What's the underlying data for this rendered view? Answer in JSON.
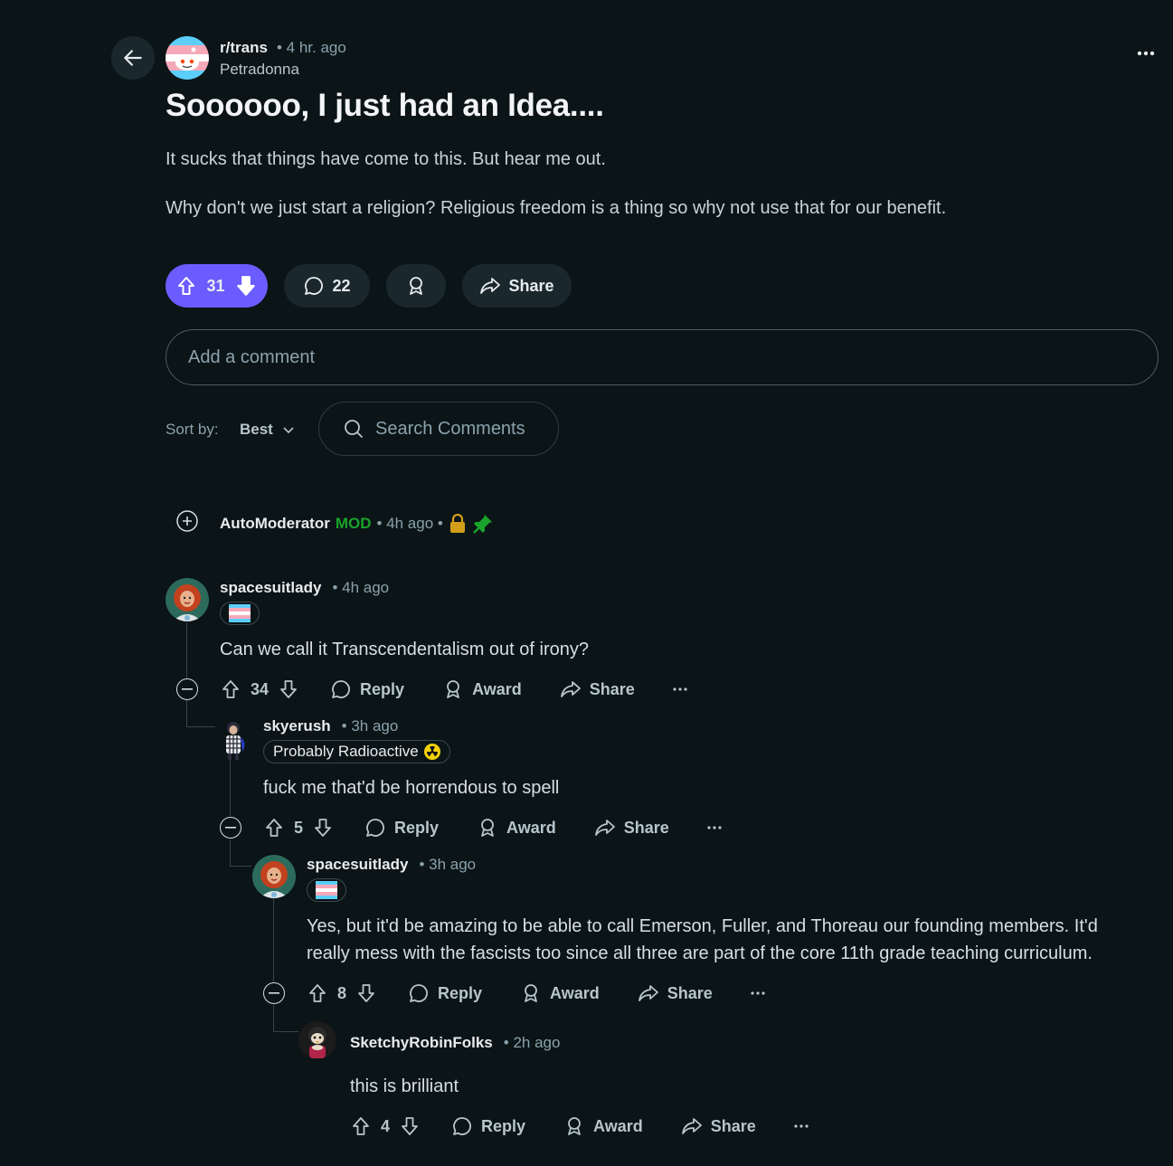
{
  "post": {
    "subreddit": "r/trans",
    "time": "• 4 hr. ago",
    "author": "Petradonna",
    "title": "Soooooo, I just had an Idea....",
    "body": [
      "It sucks that things have come to this. But hear me out.",
      "Why don't we just start a religion? Religious freedom is a thing so why not use that for our benefit."
    ],
    "votes": "31",
    "comments": "22",
    "share_label": "Share"
  },
  "add_comment_placeholder": "Add a comment",
  "sort": {
    "label": "Sort by:",
    "value": "Best"
  },
  "search_placeholder": "Search Comments",
  "colors": {
    "background": "#0b1416",
    "upvote_active": "#6a5cff",
    "mod_green": "#1aa32a"
  },
  "comments": [
    {
      "user": "AutoModerator",
      "tag": "MOD",
      "time": "• 4h ago •"
    },
    {
      "user": "spacesuitlady",
      "time": "• 4h ago",
      "text": "Can we call it Transcendentalism out of irony?",
      "votes": "34",
      "reply": "Reply",
      "award": "Award",
      "share": "Share"
    },
    {
      "user": "skyerush",
      "time": "• 3h ago",
      "flair": "Probably Radioactive",
      "text": "fuck me that'd be horrendous to spell",
      "votes": "5",
      "reply": "Reply",
      "award": "Award",
      "share": "Share"
    },
    {
      "user": "spacesuitlady",
      "time": "• 3h ago",
      "text_lines": [
        "Yes, but it'd be amazing to be able to call Emerson, Fuller, and Thoreau our founding members. It'd",
        "really mess with the fascists too since all three are part of the core 11th grade teaching curriculum."
      ],
      "votes": "8",
      "reply": "Reply",
      "award": "Award",
      "share": "Share"
    },
    {
      "user": "SketchyRobinFolks",
      "time": "• 2h ago",
      "text": "this is brilliant",
      "votes": "4",
      "reply": "Reply",
      "award": "Award",
      "share": "Share"
    }
  ]
}
